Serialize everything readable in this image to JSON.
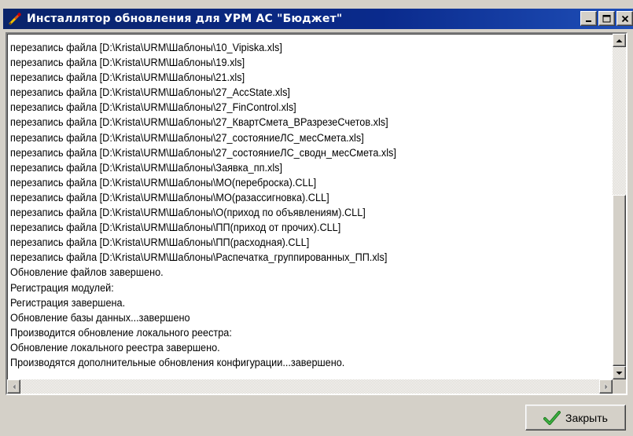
{
  "window": {
    "title": "Инсталлятор обновления для УРМ АС \"Бюджет\"",
    "title_icon": "installer-wrench-icon"
  },
  "log": {
    "lines": [
      "перезапись файла [D:\\Krista\\URM\\Шаблоны\\10_Vipiska.xls]",
      "перезапись файла [D:\\Krista\\URM\\Шаблоны\\19.xls]",
      "перезапись файла [D:\\Krista\\URM\\Шаблоны\\21.xls]",
      "перезапись файла [D:\\Krista\\URM\\Шаблоны\\27_AccState.xls]",
      "перезапись файла [D:\\Krista\\URM\\Шаблоны\\27_FinControl.xls]",
      "перезапись файла [D:\\Krista\\URM\\Шаблоны\\27_КвартСмета_ВРазрезеСчетов.xls]",
      "перезапись файла [D:\\Krista\\URM\\Шаблоны\\27_состояниеЛС_месСмета.xls]",
      "перезапись файла [D:\\Krista\\URM\\Шаблоны\\27_состояниеЛС_сводн_месСмета.xls]",
      "перезапись файла [D:\\Krista\\URM\\Шаблоны\\Заявка_пп.xls]",
      "перезапись файла [D:\\Krista\\URM\\Шаблоны\\МО(переброска).CLL]",
      "перезапись файла [D:\\Krista\\URM\\Шаблоны\\МО(разассигновка).CLL]",
      "перезапись файла [D:\\Krista\\URM\\Шаблоны\\О(приход по объявлениям).CLL]",
      "перезапись файла [D:\\Krista\\URM\\Шаблоны\\ПП(приход от прочих).CLL]",
      "перезапись файла [D:\\Krista\\URM\\Шаблоны\\ПП(расходная).CLL]",
      "перезапись файла [D:\\Krista\\URM\\Шаблоны\\Распечатка_группированных_ПП.xls]",
      "Обновление файлов завершено.",
      "Регистрация модулей:",
      "Регистрация завершена.",
      "Обновление базы данных...завершено",
      "Производится обновление локального реестра:",
      "Обновление локального реестра завершено.",
      "Производятся дополнительные обновления конфигурации...завершено."
    ]
  },
  "buttons": {
    "close_label": "Закрыть",
    "close_icon": "checkmark-icon"
  },
  "colors": {
    "titlebar": "#0a2a8c",
    "face": "#d4d0c8",
    "check_green": "#2e8b2e"
  }
}
